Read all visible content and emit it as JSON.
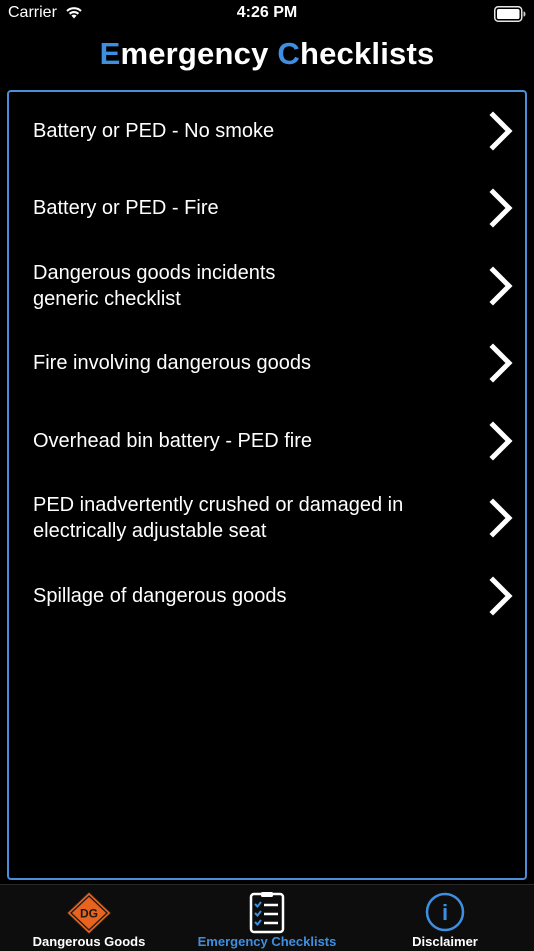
{
  "status_bar": {
    "carrier": "Carrier",
    "time": "4:26 PM"
  },
  "header": {
    "title_first_initial": "E",
    "title_first_rest": "mergency ",
    "title_second_initial": "C",
    "title_second_rest": "hecklists",
    "accent_color": "#3e8fe0"
  },
  "checklists": [
    {
      "label": "Battery or PED - No smoke"
    },
    {
      "label": "Battery or PED - Fire"
    },
    {
      "label": "Dangerous goods incidents\ngeneric checklist"
    },
    {
      "label": "Fire involving dangerous goods"
    },
    {
      "label": "Overhead bin battery - PED fire"
    },
    {
      "label": "PED inadvertently crushed or damaged in\nelectrically adjustable seat"
    },
    {
      "label": "Spillage of dangerous goods"
    }
  ],
  "tab_bar": {
    "tabs": [
      {
        "label": "Dangerous Goods",
        "icon": "dg-diamond-icon",
        "icon_text": "DG",
        "active": false
      },
      {
        "label": "Emergency Checklists",
        "icon": "checklist-icon",
        "active": true
      },
      {
        "label": "Disclaimer",
        "icon": "info-icon",
        "icon_text": "i",
        "active": false
      }
    ],
    "active_color": "#3e8fe0",
    "dg_color": "#e8641e"
  }
}
